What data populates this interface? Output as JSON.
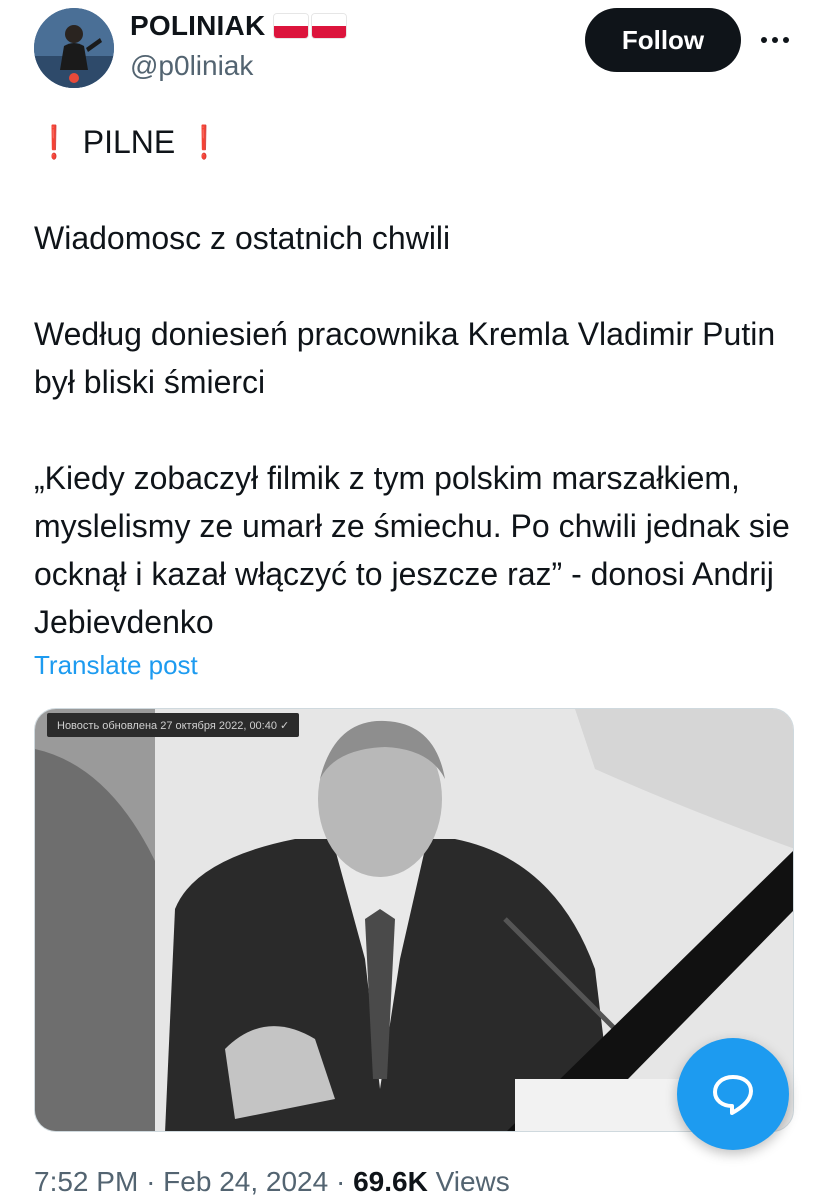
{
  "author": {
    "name": "POLINIAK",
    "handle": "@p0liniak",
    "flags": [
      "poland-flag",
      "poland-flag"
    ]
  },
  "follow_label": "Follow",
  "more_icon": "more-horizontal-icon",
  "tweet": {
    "headline": "PILNE",
    "alert_icon": "red-exclamation-icon",
    "alert_color": "#e0245e",
    "line1": "Wiadomosc z ostatnich chwili",
    "line2": "Według doniesień pracownika Kremla Vladimir Putin był bliski śmierci",
    "line3": "„Kiedy zobaczył filmik z tym polskim marszałkiem, myslelismy ze umarł ze śmiechu. Po chwili jednak sie ocknął i kazał włączyć to jeszcze raz” - donosi Andrij Jebievdenko"
  },
  "translate_label": "Translate post",
  "media": {
    "caption": "Новость обновлена 27 октября 2022, 00:40  ✓"
  },
  "meta": {
    "time": "7:52 PM",
    "date": "Feb 24, 2024",
    "views_count": "69.6K",
    "views_label": "Views"
  },
  "colors": {
    "accent": "#1d9bf0",
    "text": "#0f1419",
    "secondary": "#536471",
    "flag_red": "#dc143c"
  },
  "fab_icon": "compose-reply-icon"
}
